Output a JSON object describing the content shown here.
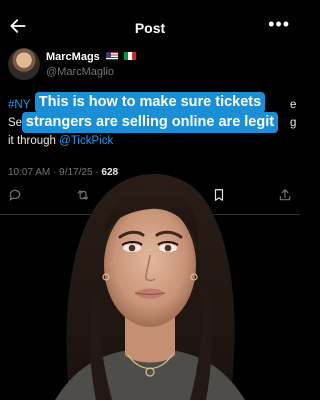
{
  "header": {
    "title": "Post",
    "more_icon": "more-horizontal-icon",
    "back_icon": "arrow-left-icon"
  },
  "author": {
    "name": "MarcMags",
    "handle": "@MarcMaglio",
    "flags": [
      "us-flag",
      "italy-flag"
    ]
  },
  "tweet": {
    "line1_start": "#NY",
    "line1_end": "e",
    "line2_start": "Se",
    "line2_end": "g",
    "line3_text": "it through ",
    "line3_link": "@TickPick"
  },
  "meta": {
    "time": "10:07 AM · 9/17/25 · ",
    "views": "628"
  },
  "caption": {
    "line1": "This is how to make sure tickets",
    "line2": "strangers are selling online are legit"
  },
  "colors": {
    "accent": "#1d9bf0",
    "caption_bg": "#1a8fd6",
    "background": "#000000"
  }
}
